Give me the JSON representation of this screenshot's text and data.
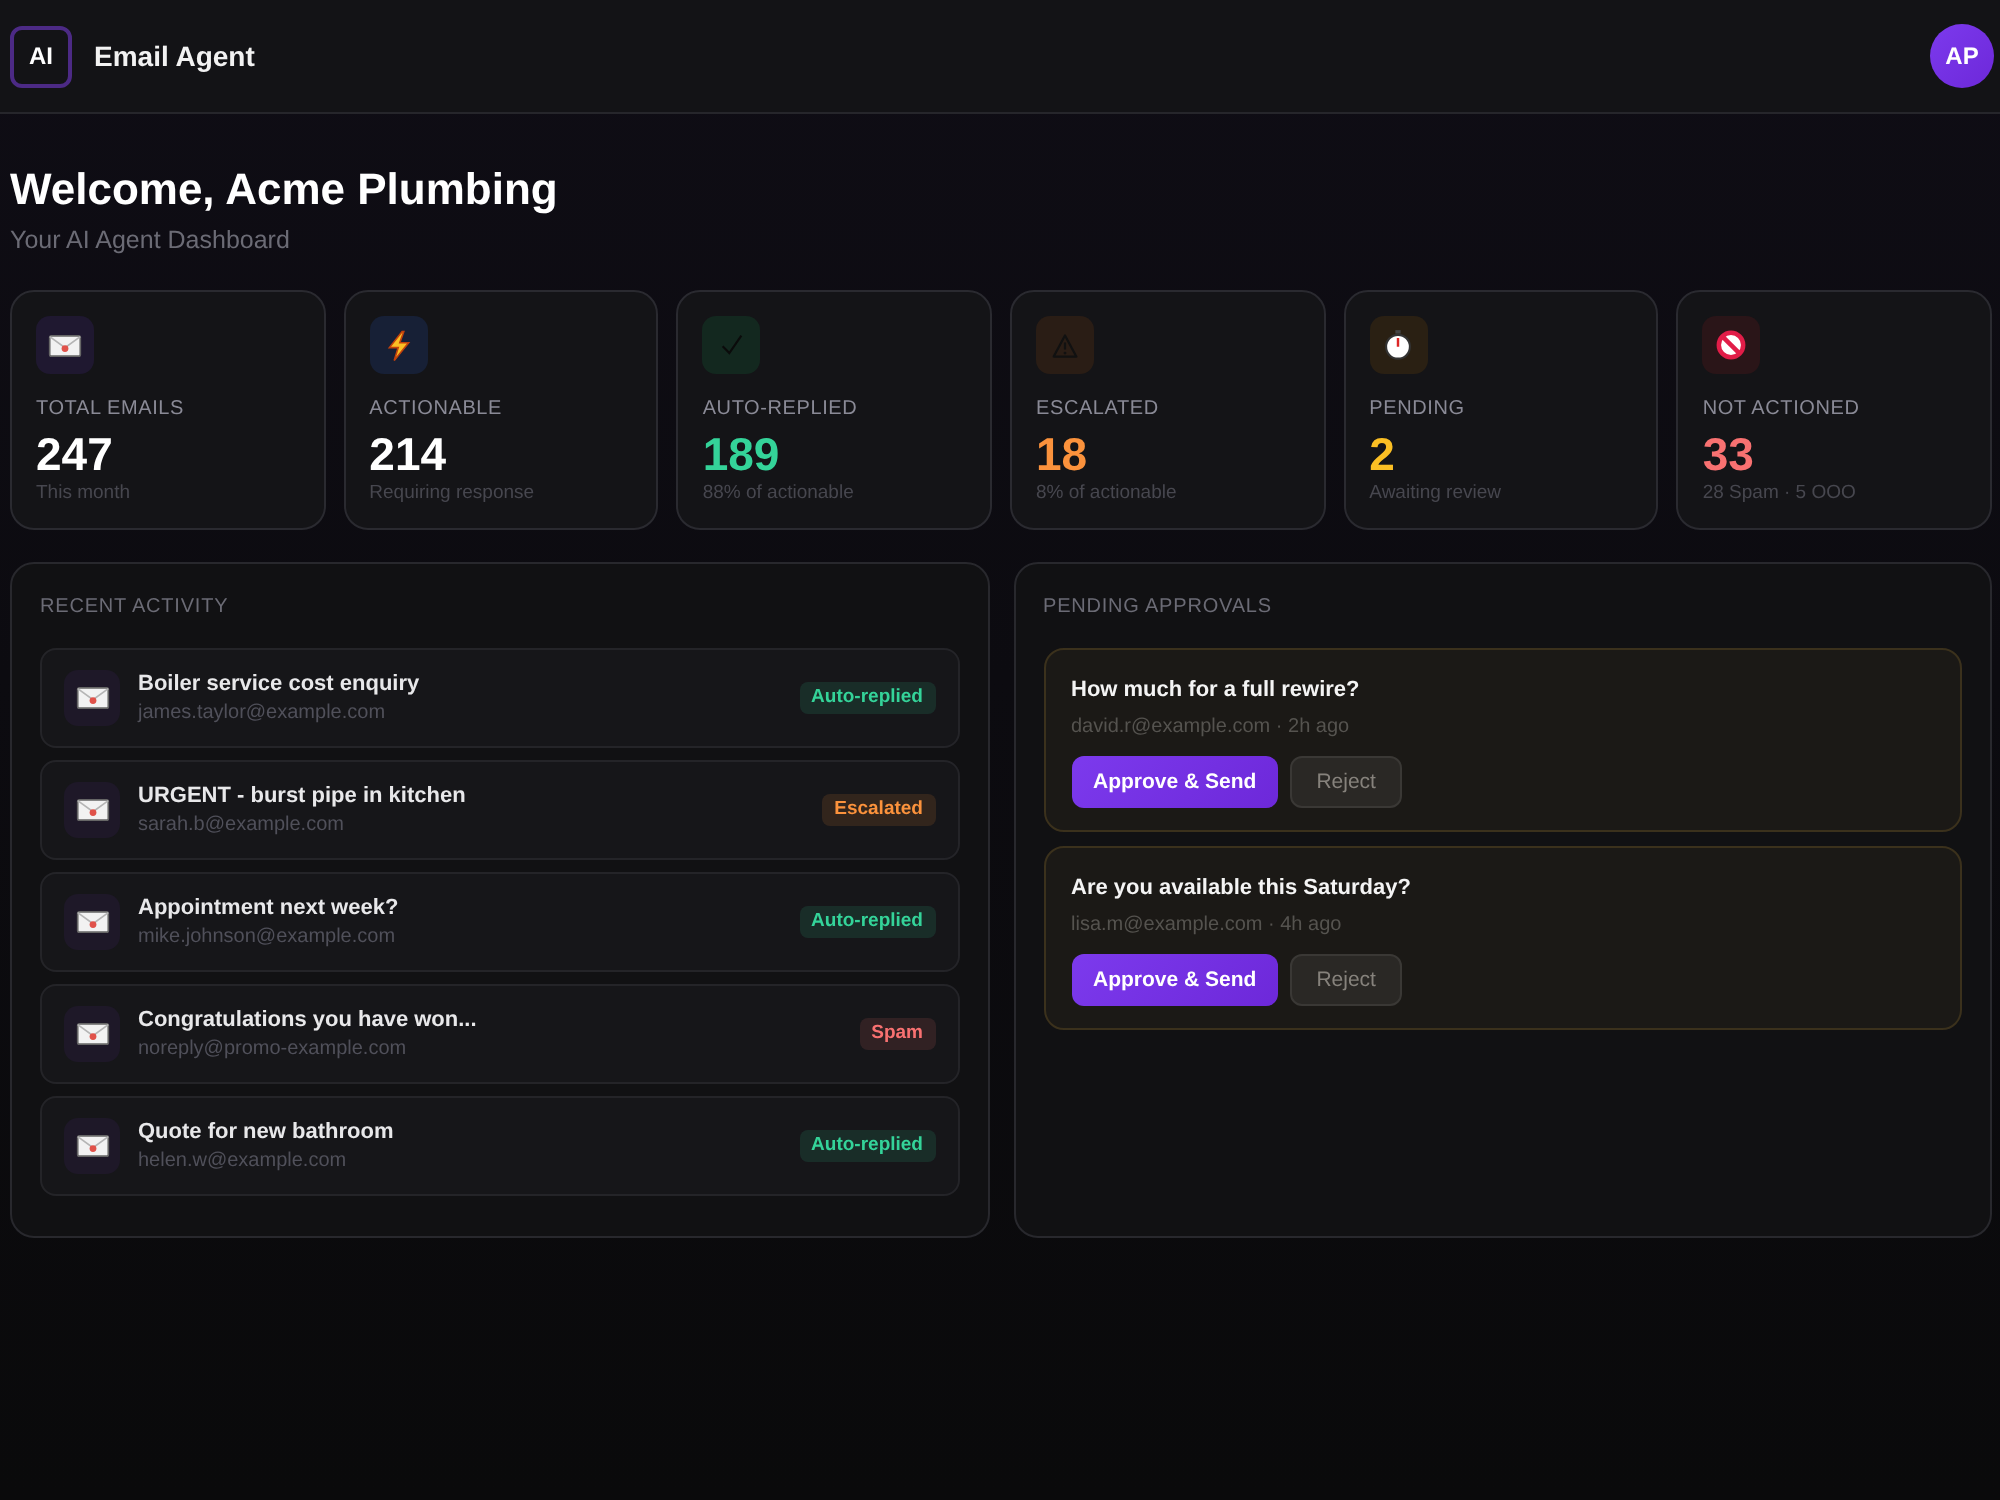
{
  "header": {
    "logo": "AI",
    "title": "Email Agent",
    "avatar": "AP"
  },
  "welcome": {
    "title": "Welcome, Acme Plumbing",
    "subtitle": "Your AI Agent Dashboard"
  },
  "stats": [
    {
      "kind": "envelope",
      "label": "TOTAL EMAILS",
      "value": "247",
      "note": "This month",
      "color": "#ffffff"
    },
    {
      "kind": "bolt",
      "label": "ACTIONABLE",
      "value": "214",
      "note": "Requiring response",
      "color": "#ffffff"
    },
    {
      "kind": "check",
      "label": "AUTO-REPLIED",
      "value": "189",
      "note": "88% of actionable",
      "color": "#34d399"
    },
    {
      "kind": "warning",
      "label": "ESCALATED",
      "value": "18",
      "note": "8% of actionable",
      "color": "#fb923c"
    },
    {
      "kind": "clock",
      "label": "PENDING",
      "value": "2",
      "note": "Awaiting review",
      "color": "#fbbf24"
    },
    {
      "kind": "blocked",
      "label": "NOT ACTIONED",
      "value": "33",
      "note": "28 Spam · 5 OOO",
      "color": "#f87171"
    }
  ],
  "recent_activity": {
    "title": "RECENT ACTIVITY",
    "items": [
      {
        "subject": "Boiler service cost enquiry",
        "sender": "james.taylor@example.com",
        "status": "Auto-replied",
        "color": "#34d399"
      },
      {
        "subject": "URGENT - burst pipe in kitchen",
        "sender": "sarah.b@example.com",
        "status": "Escalated",
        "color": "#fb923c"
      },
      {
        "subject": "Appointment next week?",
        "sender": "mike.johnson@example.com",
        "status": "Auto-replied",
        "color": "#34d399"
      },
      {
        "subject": "Congratulations you have won...",
        "sender": "noreply@promo-example.com",
        "status": "Spam",
        "color": "#f87171"
      },
      {
        "subject": "Quote for new bathroom",
        "sender": "helen.w@example.com",
        "status": "Auto-replied",
        "color": "#34d399"
      }
    ]
  },
  "pending_approvals": {
    "title": "PENDING APPROVALS",
    "items": [
      {
        "subject": "How much for a full rewire?",
        "meta": "david.r@example.com · 2h ago",
        "approve": "Approve & Send",
        "reject": "Reject"
      },
      {
        "subject": "Are you available this Saturday?",
        "meta": "lisa.m@example.com · 4h ago",
        "approve": "Approve & Send",
        "reject": "Reject"
      }
    ]
  }
}
